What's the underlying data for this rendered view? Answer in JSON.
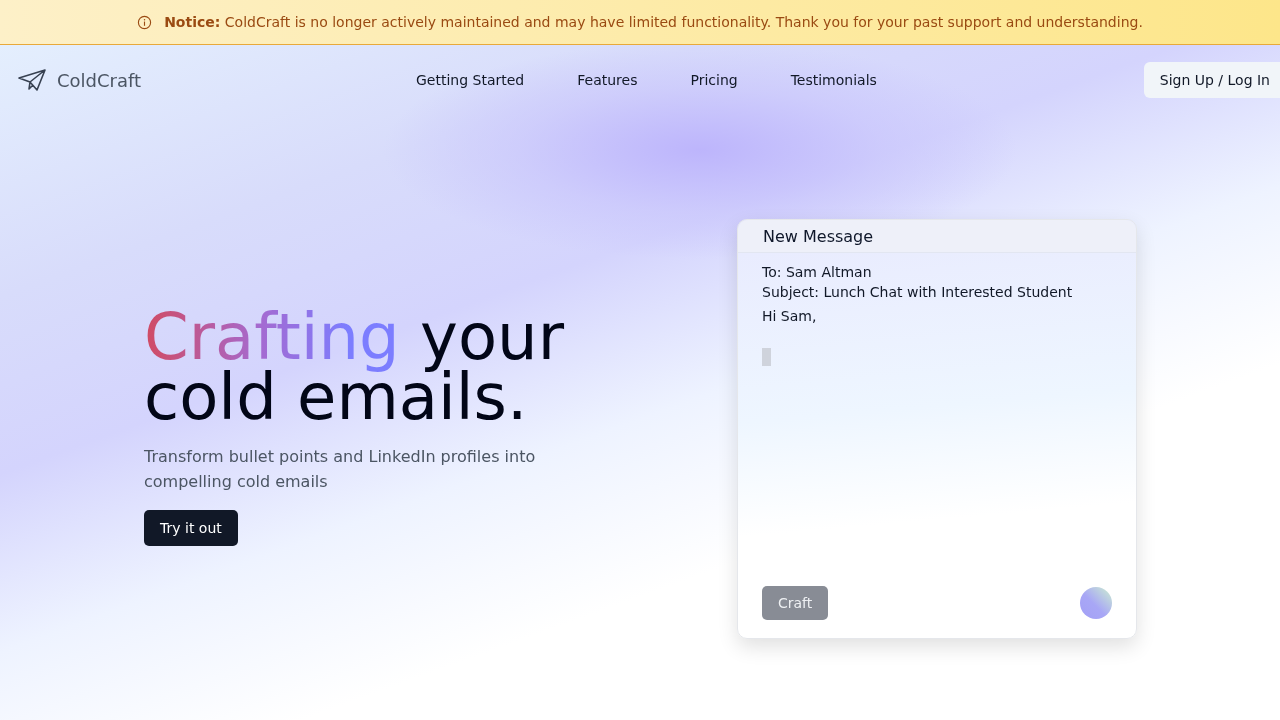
{
  "notice": {
    "label": "Notice:",
    "text": "ColdCraft is no longer actively maintained and may have limited functionality. Thank you for your past support and understanding."
  },
  "brand": {
    "name": "ColdCraft"
  },
  "nav": [
    {
      "label": "Getting Started"
    },
    {
      "label": "Features"
    },
    {
      "label": "Pricing"
    },
    {
      "label": "Testimonials"
    }
  ],
  "auth_button": "Sign Up / Log In",
  "hero": {
    "title_highlight": "Crafting",
    "title_rest": " your cold emails.",
    "subtitle": "Transform bullet points and LinkedIn profiles into compelling cold emails",
    "cta": "Try it out"
  },
  "composer": {
    "title": "New Message",
    "to": "To: Sam Altman",
    "subject": "Subject: Lunch Chat with Interested Student",
    "greeting": "Hi Sam,",
    "button": "Craft",
    "button_disabled": true
  }
}
